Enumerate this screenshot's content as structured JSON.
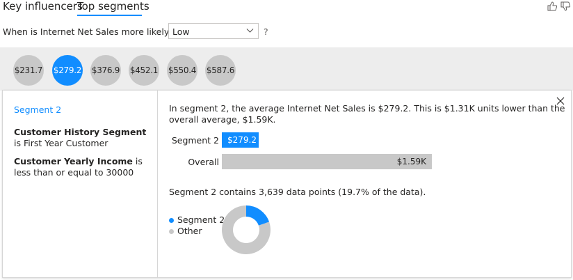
{
  "tabs": [
    {
      "label": "Key influencers",
      "active": false
    },
    {
      "label": "Top segments",
      "active": true
    }
  ],
  "feedback": {
    "up_icon": "thumbs-up-icon",
    "down_icon": "thumbs-down-icon"
  },
  "question": {
    "prefix": "When is Internet Net Sales more likely to be",
    "selected_value": "Low",
    "help": "?"
  },
  "segments": [
    "$231.7",
    "$279.2",
    "$376.9",
    "$452.1",
    "$550.4",
    "$587.6"
  ],
  "selected_segment_index": 1,
  "detail": {
    "segment_name": "Segment 2",
    "conditions": [
      {
        "field": "Customer History Segment",
        "text": " is First Year Customer"
      },
      {
        "field": "Customer Yearly Income",
        "text": " is less than or equal to 30000"
      }
    ],
    "summary": "In segment 2, the average Internet Net Sales is $279.2. This is $1.31K units lower than the overall average, $1.59K.",
    "points_text": "Segment 2 contains 3,639 data points (19.7% of the data)."
  },
  "chart_data": [
    {
      "type": "bar",
      "categories": [
        "Segment 2",
        "Overall"
      ],
      "values": [
        279.2,
        1590
      ],
      "data_labels": [
        "$279.2",
        "$1.59K"
      ],
      "colors": [
        "#118dff",
        "#c8c8c8"
      ]
    },
    {
      "type": "pie",
      "categories": [
        "Segment 2",
        "Other"
      ],
      "values": [
        19.7,
        80.3
      ],
      "colors": [
        "#118dff",
        "#c8c8c8"
      ],
      "legend": "left"
    }
  ],
  "colors": {
    "accent": "#118dff",
    "neutral": "#c8c8c8"
  }
}
